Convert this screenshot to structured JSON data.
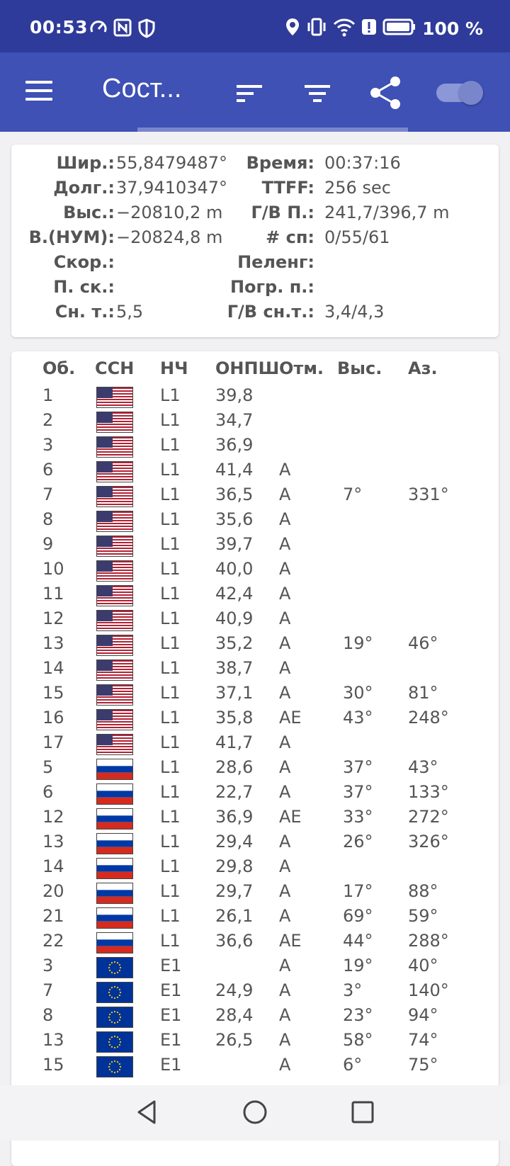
{
  "status_bar": {
    "time": "00:53",
    "battery": "100 %"
  },
  "app_bar": {
    "title": "Сост...",
    "icons": [
      "menu-icon",
      "sort-icon",
      "filter-icon",
      "share-icon",
      "toggle-switch"
    ]
  },
  "colors": {
    "status_bar": "#2f3b9a",
    "app_bar": "#3f51b5",
    "accent": "#7986cb"
  },
  "info": {
    "rows": [
      {
        "l1": "Шир.:",
        "v1": "55,8479487°",
        "l2": "Время:",
        "v2": "00:37:16"
      },
      {
        "l1": "Долг.:",
        "v1": "37,9410347°",
        "l2": "TTFF:",
        "v2": "256 sec"
      },
      {
        "l1": "Выс.:",
        "v1": "−20810,2 m",
        "l2": "Г/В П.:",
        "v2": "241,7/396,7 m"
      },
      {
        "l1": "В.(НУМ):",
        "v1": "−20824,8 m",
        "l2": "# сп:",
        "v2": "0/55/61"
      },
      {
        "l1": "Скор.:",
        "v1": "",
        "l2": "Пеленг:",
        "v2": ""
      },
      {
        "l1": "П. ск.:",
        "v1": "",
        "l2": "Погр. п.:",
        "v2": ""
      },
      {
        "l1": "Сн. т.:",
        "v1": "5,5",
        "l2": "Г/В сн.т.:",
        "v2": "3,4/4,3"
      }
    ]
  },
  "satellites": {
    "headers": [
      "Об.",
      "ССН",
      "НЧ",
      "ОНПШ",
      "Отм.",
      "Выс.",
      "Аз."
    ],
    "rows": [
      {
        "id": "1",
        "flag": "us",
        "freq": "L1",
        "snr": "39,8",
        "mark": "",
        "el": "",
        "az": ""
      },
      {
        "id": "2",
        "flag": "us",
        "freq": "L1",
        "snr": "34,7",
        "mark": "",
        "el": "",
        "az": ""
      },
      {
        "id": "3",
        "flag": "us",
        "freq": "L1",
        "snr": "36,9",
        "mark": "",
        "el": "",
        "az": ""
      },
      {
        "id": "6",
        "flag": "us",
        "freq": "L1",
        "snr": "41,4",
        "mark": "A",
        "el": "",
        "az": ""
      },
      {
        "id": "7",
        "flag": "us",
        "freq": "L1",
        "snr": "36,5",
        "mark": "A",
        "el": "7°",
        "az": "331°"
      },
      {
        "id": "8",
        "flag": "us",
        "freq": "L1",
        "snr": "35,6",
        "mark": "A",
        "el": "",
        "az": ""
      },
      {
        "id": "9",
        "flag": "us",
        "freq": "L1",
        "snr": "39,7",
        "mark": "A",
        "el": "",
        "az": ""
      },
      {
        "id": "10",
        "flag": "us",
        "freq": "L1",
        "snr": "40,0",
        "mark": "A",
        "el": "",
        "az": ""
      },
      {
        "id": "11",
        "flag": "us",
        "freq": "L1",
        "snr": "42,4",
        "mark": "A",
        "el": "",
        "az": ""
      },
      {
        "id": "12",
        "flag": "us",
        "freq": "L1",
        "snr": "40,9",
        "mark": "A",
        "el": "",
        "az": ""
      },
      {
        "id": "13",
        "flag": "us",
        "freq": "L1",
        "snr": "35,2",
        "mark": "A",
        "el": "19°",
        "az": "46°"
      },
      {
        "id": "14",
        "flag": "us",
        "freq": "L1",
        "snr": "38,7",
        "mark": "A",
        "el": "",
        "az": ""
      },
      {
        "id": "15",
        "flag": "us",
        "freq": "L1",
        "snr": "37,1",
        "mark": "A",
        "el": "30°",
        "az": "81°"
      },
      {
        "id": "16",
        "flag": "us",
        "freq": "L1",
        "snr": "35,8",
        "mark": "AE",
        "el": "43°",
        "az": "248°"
      },
      {
        "id": "17",
        "flag": "us",
        "freq": "L1",
        "snr": "41,7",
        "mark": "A",
        "el": "",
        "az": ""
      },
      {
        "id": "5",
        "flag": "ru",
        "freq": "L1",
        "snr": "28,6",
        "mark": "A",
        "el": "37°",
        "az": "43°"
      },
      {
        "id": "6",
        "flag": "ru",
        "freq": "L1",
        "snr": "22,7",
        "mark": "A",
        "el": "37°",
        "az": "133°"
      },
      {
        "id": "12",
        "flag": "ru",
        "freq": "L1",
        "snr": "36,9",
        "mark": "AE",
        "el": "33°",
        "az": "272°"
      },
      {
        "id": "13",
        "flag": "ru",
        "freq": "L1",
        "snr": "29,4",
        "mark": "A",
        "el": "26°",
        "az": "326°"
      },
      {
        "id": "14",
        "flag": "ru",
        "freq": "L1",
        "snr": "29,8",
        "mark": "A",
        "el": "",
        "az": ""
      },
      {
        "id": "20",
        "flag": "ru",
        "freq": "L1",
        "snr": "29,7",
        "mark": "A",
        "el": "17°",
        "az": "88°"
      },
      {
        "id": "21",
        "flag": "ru",
        "freq": "L1",
        "snr": "26,1",
        "mark": "A",
        "el": "69°",
        "az": "59°"
      },
      {
        "id": "22",
        "flag": "ru",
        "freq": "L1",
        "snr": "36,6",
        "mark": "AE",
        "el": "44°",
        "az": "288°"
      },
      {
        "id": "3",
        "flag": "eu",
        "freq": "E1",
        "snr": "",
        "mark": "A",
        "el": "19°",
        "az": "40°"
      },
      {
        "id": "7",
        "flag": "eu",
        "freq": "E1",
        "snr": "24,9",
        "mark": "A",
        "el": "3°",
        "az": "140°"
      },
      {
        "id": "8",
        "flag": "eu",
        "freq": "E1",
        "snr": "28,4",
        "mark": "A",
        "el": "23°",
        "az": "94°"
      },
      {
        "id": "13",
        "flag": "eu",
        "freq": "E1",
        "snr": "26,5",
        "mark": "A",
        "el": "58°",
        "az": "74°"
      },
      {
        "id": "15",
        "flag": "eu",
        "freq": "E1",
        "snr": "",
        "mark": "A",
        "el": "6°",
        "az": "75°"
      }
    ]
  },
  "nav_bar": {
    "icons": [
      "back-icon",
      "home-icon",
      "recents-icon"
    ]
  }
}
